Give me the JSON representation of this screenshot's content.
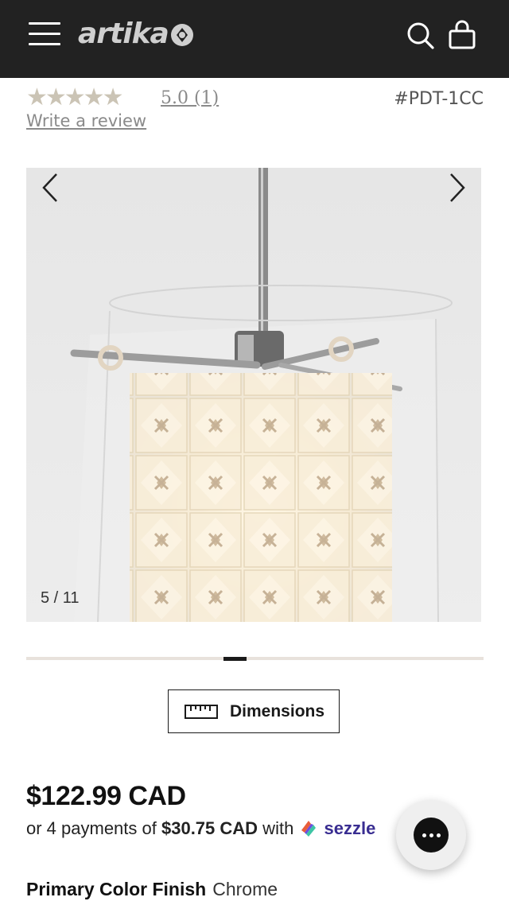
{
  "header": {
    "logo_text": "artika",
    "bg_color": "#222222"
  },
  "rating": {
    "stars_display": "★★★★★",
    "score_text": "5.0",
    "count_text": "(1)",
    "value": 5.0,
    "max": 5
  },
  "sku": "#PDT-1CC",
  "write_review": "Write a review",
  "gallery": {
    "counter": "5 / 11",
    "current": 5,
    "total": 11,
    "progress_fraction": 0.45
  },
  "dimensions_button": {
    "label": "Dimensions"
  },
  "price": {
    "main": "$122.99 CAD",
    "payments_prefix": "or 4 payments of ",
    "payments_amount": "$30.75 CAD",
    "payments_with": " with ",
    "provider": "sezzle"
  },
  "finish": {
    "label": "Primary Color Finish",
    "value": "Chrome"
  },
  "icons": {
    "menu": "hamburger-icon",
    "search": "search-icon",
    "cart": "shopping-bag-icon",
    "ruler": "ruler-icon",
    "chat": "chat-icon",
    "prev": "chevron-left-icon",
    "next": "chevron-right-icon"
  }
}
